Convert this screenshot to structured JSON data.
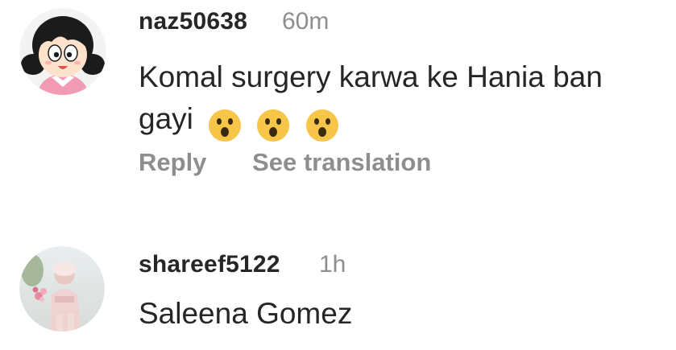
{
  "comments": [
    {
      "username": "naz50638",
      "time": "60m",
      "text": "Komal surgery karwa ke Hania ban gayi",
      "emojis": [
        "hushed-face-emoji",
        "hushed-face-emoji",
        "hushed-face-emoji"
      ],
      "actions": {
        "reply": "Reply",
        "translate": "See translation"
      }
    },
    {
      "username": "shareef5122",
      "time": "1h",
      "text": "Saleena Gomez"
    }
  ],
  "colors": {
    "text_primary": "#262626",
    "text_secondary": "#8e8e8e",
    "emoji_face": "#F7C548"
  },
  "icons": {
    "avatar_1": "cartoon-girl-avatar",
    "avatar_2": "photo-avatar"
  }
}
